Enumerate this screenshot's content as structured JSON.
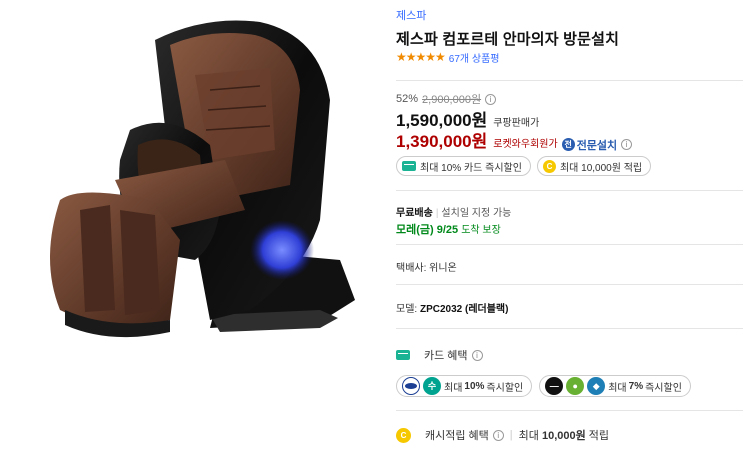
{
  "product": {
    "brand": "제스파",
    "title": "제스파 컴포르테 안마의자 방문설치",
    "stars": "★★★★★",
    "review_count": "67개 상품평",
    "image_icon": "massage-chair-image"
  },
  "price": {
    "discount_rate": "52%",
    "original_price": "2,900,000원",
    "coupang_price": "1,590,000원",
    "coupang_label": "쿠팡판매가",
    "rocket_price": "1,390,000원",
    "rocket_label": "로켓와우회원가",
    "install_badge": "전문설치",
    "install_badge_icon": "전"
  },
  "chips": [
    {
      "icon": "card-icon",
      "label": "최대 10% 카드 즉시할인"
    },
    {
      "icon": "coin-icon",
      "label": "최대 10,000원 적립"
    }
  ],
  "shipping": {
    "free_label": "무료배송",
    "install_label": "설치일 지정 가능",
    "arrival": "모레(금) 9/25",
    "guarantee": "도착 보장"
  },
  "seller": "택배사: 위니온",
  "model": {
    "label": "모델:",
    "value": "ZPC2032 (레더블랙)"
  },
  "card_benefit": {
    "title": "카드 혜택",
    "pills": [
      {
        "prefix": "최대",
        "rate": "10%",
        "suffix": "즉시할인"
      },
      {
        "prefix": "최대",
        "rate": "7%",
        "suffix": "즉시할인"
      }
    ]
  },
  "cash": {
    "title": "캐시적립 혜택",
    "detail_prefix": "최대",
    "amount": "10,000원",
    "detail_suffix": "적립",
    "coin_glyph": "C"
  },
  "colors": {
    "brand_blue": "#346aff",
    "rocket_red": "#ae0000",
    "arrival_green": "#00891a",
    "star_orange": "#f08a00"
  }
}
